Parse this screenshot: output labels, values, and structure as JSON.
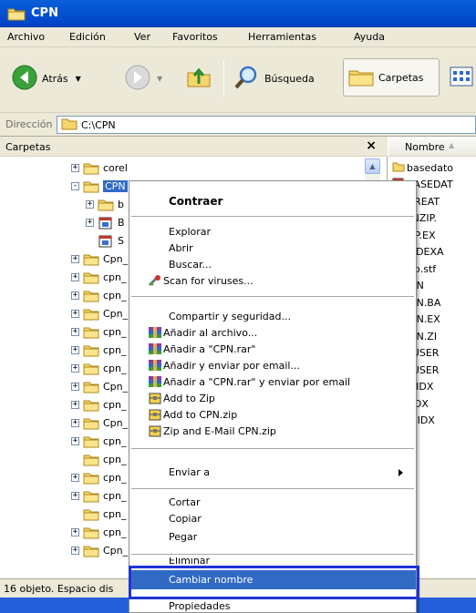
{
  "window": {
    "title": "CPN"
  },
  "menubar": [
    "Archivo",
    "Edición",
    "Ver",
    "Favoritos",
    "Herramientas",
    "Ayuda"
  ],
  "toolbar": {
    "back": "Atrás",
    "search": "Búsqueda",
    "folders": "Carpetas"
  },
  "address": {
    "label": "Dirección",
    "value": "C:\\CPN"
  },
  "folder_pane": {
    "title": "Carpetas",
    "close": "×",
    "items": [
      {
        "label": "corel",
        "expander": "+"
      },
      {
        "label": "CPN",
        "expander": "−"
      },
      {
        "label": "b",
        "expander": "+"
      },
      {
        "label": "B",
        "expander": "+"
      },
      {
        "label": "S",
        "expander": ""
      },
      {
        "label": "Cpn_",
        "expander": "+"
      },
      {
        "label": "cpn_",
        "expander": "+"
      },
      {
        "label": "cpn_",
        "expander": "+"
      },
      {
        "label": "Cpn_",
        "expander": "+"
      },
      {
        "label": "cpn_",
        "expander": "+"
      },
      {
        "label": "cpn_",
        "expander": "+"
      },
      {
        "label": "cpn_",
        "expander": "+"
      },
      {
        "label": "Cpn_",
        "expander": "+"
      },
      {
        "label": "cpn_",
        "expander": "+"
      },
      {
        "label": "Cpn_",
        "expander": "+"
      },
      {
        "label": "cpn_",
        "expander": "+"
      },
      {
        "label": "cpn_",
        "expander": ""
      },
      {
        "label": "cpn_",
        "expander": "+"
      },
      {
        "label": "cpn_",
        "expander": "+"
      },
      {
        "label": "cpn_",
        "expander": ""
      },
      {
        "label": "cpn_",
        "expander": "+"
      },
      {
        "label": "Cpn_",
        "expander": "+"
      }
    ]
  },
  "file_pane": {
    "header": "Nombre",
    "files": [
      "basedato",
      "BASEDAT",
      "MSCREAT",
      "PKUNZIP.",
      "PKZIP.EX",
      "REINDEXA",
      "setup.stf",
      "SICON",
      "SICON.BA",
      "SICON.EX",
      "SICON.ZI",
      "FOXUSER",
      "FOXUSER",
      "XXX.IDX",
      "act.IDX",
      "actp.IDX"
    ]
  },
  "status": {
    "text": "16 objeto. Espacio dis"
  },
  "context_menu": {
    "contraer": "Contraer",
    "explorar": "Explorar",
    "abrir": "Abrir",
    "buscar": "Buscar...",
    "scan": "Scan for viruses...",
    "compartir": "Compartir y seguridad...",
    "anadir": "Añadir al archivo...",
    "anadir_cpn": "Añadir a \"CPN.rar\"",
    "anadir_email": "Añadir y enviar por email...",
    "anadir_cpn_email": "Añadir a \"CPN.rar\" y enviar por email",
    "add_zip": "Add to Zip",
    "add_cpn_zip": "Add to CPN.zip",
    "zip_email": "Zip and E-Mail CPN.zip",
    "enviar": "Enviar a",
    "cortar": "Cortar",
    "copiar": "Copiar",
    "pegar": "Pegar",
    "eliminar": "Eliminar",
    "cambiar": "Cambiar nombre",
    "propiedades": "Propiedades"
  },
  "colors": {
    "selection": "#316ac5",
    "highlight_box": "#1e34d6",
    "title_bar": "#0453d3"
  }
}
